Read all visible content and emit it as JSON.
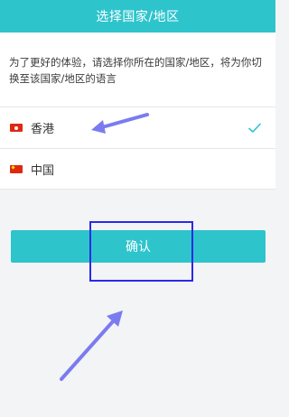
{
  "colors": {
    "accent": "#2ec4cc",
    "annotation": "#7b7bf0",
    "annotation_box": "#2a2ae8",
    "check": "#2ec4cc"
  },
  "header": {
    "title": "选择国家/地区"
  },
  "description": "为了更好的体验，请选择你所在的国家/地区，将为你切换至该国家/地区的语言",
  "regions": [
    {
      "label": "香港",
      "flag": "hong-kong-flag-icon",
      "selected": true
    },
    {
      "label": "中国",
      "flag": "china-flag-icon",
      "selected": false
    }
  ],
  "confirm_label": "确认",
  "icons": {
    "check": "check-icon"
  }
}
